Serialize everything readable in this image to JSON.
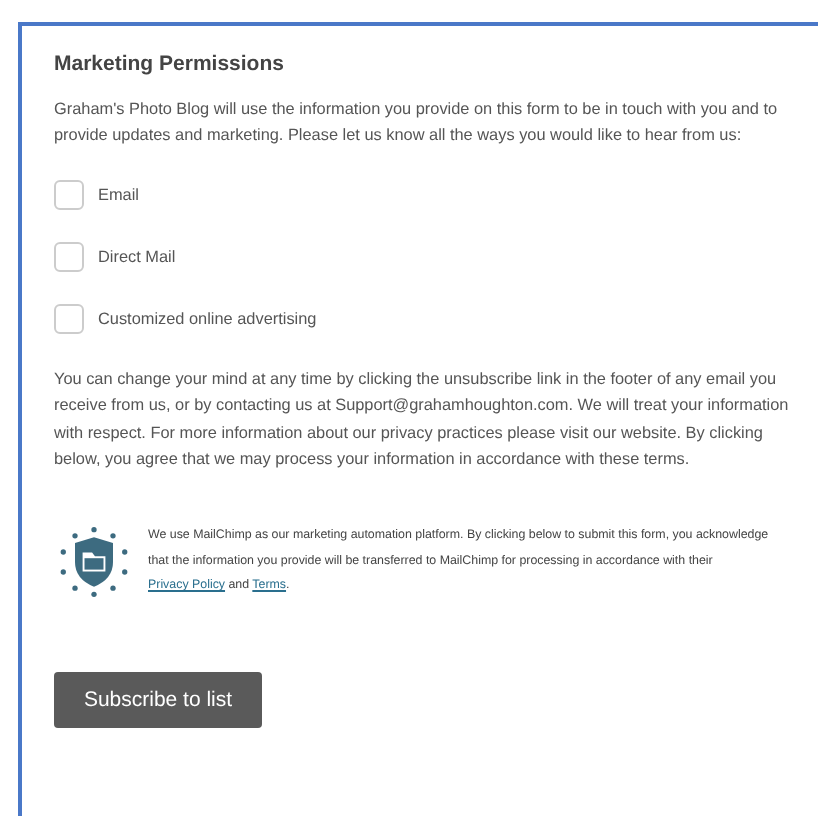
{
  "section": {
    "title": "Marketing Permissions",
    "intro": "Graham's Photo Blog will use the information you provide on this form to be in touch with you and to provide updates and marketing. Please let us know all the ways you would like to hear from us:"
  },
  "options": [
    {
      "label": "Email",
      "checked": false
    },
    {
      "label": "Direct Mail",
      "checked": false
    },
    {
      "label": "Customized online advertising",
      "checked": false
    }
  ],
  "notice": "You can change your mind at any time by clicking the unsubscribe link in the footer of any email you receive from us, or by contacting us at Support@grahamhoughton.com. We will treat your information with respect. For more information about our privacy practices please visit our website. By clicking below, you agree that we may process your information in accordance with these terms.",
  "mailchimp": {
    "text": "We use MailChimp as our marketing automation platform. By clicking below to submit this form, you acknowledge that the information you provide will be transferred to MailChimp for processing in accordance with their",
    "privacy_link": "Privacy Policy",
    "between": "and",
    "terms_link": "Terms",
    "end": "."
  },
  "submit_button": "Subscribe to list"
}
